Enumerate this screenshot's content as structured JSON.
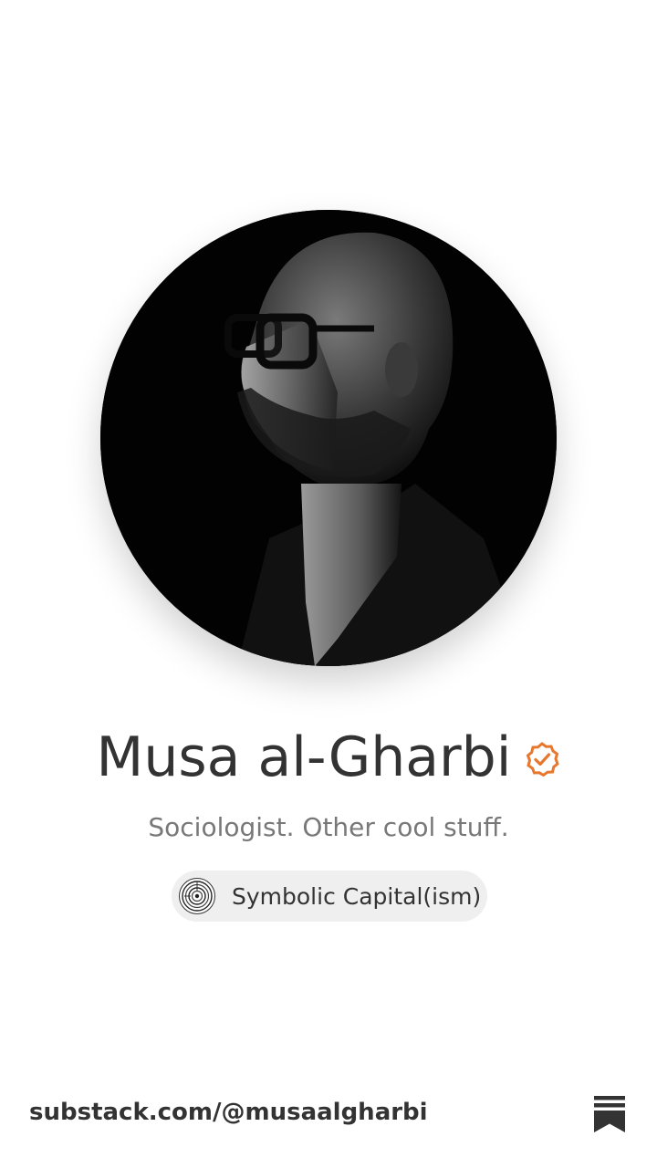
{
  "profile": {
    "name": "Musa al-Gharbi",
    "bio": "Sociologist. Other cool stuff.",
    "verified_icon": "verified-badge-icon",
    "accent_color": "#e8772e"
  },
  "publication": {
    "name": "Symbolic Capital(ism)",
    "logo_icon": "publication-logo-icon"
  },
  "footer": {
    "url": "substack.com/@musaalgharbi",
    "brand_icon": "substack-bookmark-icon"
  }
}
